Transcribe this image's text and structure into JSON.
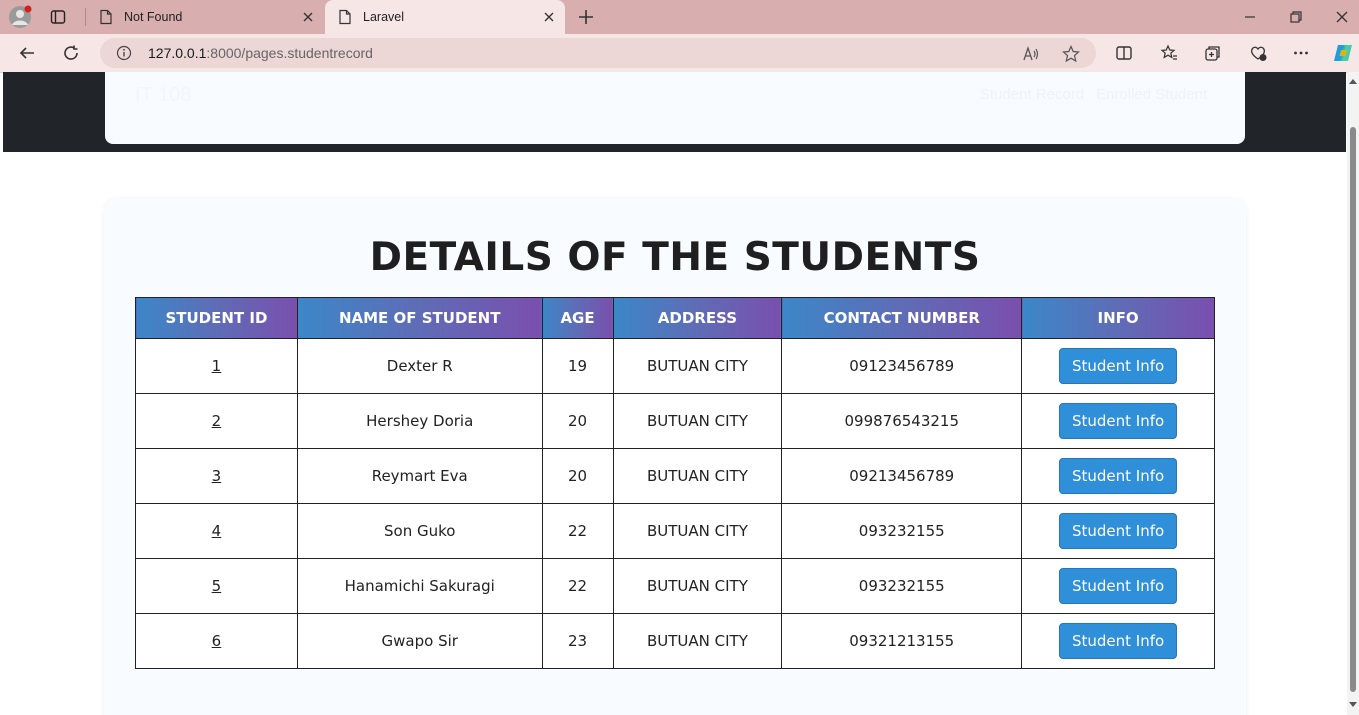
{
  "browser": {
    "tabs": [
      {
        "title": "Not Found",
        "active": false
      },
      {
        "title": "Laravel",
        "active": true
      }
    ],
    "url": {
      "host": "127.0.0.1",
      "path": ":8000/pages.studentrecord"
    }
  },
  "site": {
    "brand": "IT 108",
    "nav": [
      "Student Record",
      "Enrolled Student"
    ]
  },
  "page": {
    "title": "DETAILS OF THE STUDENTS"
  },
  "table": {
    "headers": [
      "STUDENT ID",
      "NAME OF STUDENT",
      "AGE",
      "ADDRESS",
      "CONTACT NUMBER",
      "INFO"
    ],
    "button_label": "Student Info",
    "rows": [
      {
        "id": "1",
        "name": "Dexter R",
        "age": "19",
        "address": "BUTUAN CITY",
        "contact": "09123456789"
      },
      {
        "id": "2",
        "name": "Hershey Doria",
        "age": "20",
        "address": "BUTUAN CITY",
        "contact": "099876543215"
      },
      {
        "id": "3",
        "name": "Reymart Eva",
        "age": "20",
        "address": "BUTUAN CITY",
        "contact": "09213456789"
      },
      {
        "id": "4",
        "name": "Son Guko",
        "age": "22",
        "address": "BUTUAN CITY",
        "contact": "093232155"
      },
      {
        "id": "5",
        "name": "Hanamichi Sakuragi",
        "age": "22",
        "address": "BUTUAN CITY",
        "contact": "093232155"
      },
      {
        "id": "6",
        "name": "Gwapo Sir",
        "age": "23",
        "address": "BUTUAN CITY",
        "contact": "09321213155"
      }
    ]
  },
  "colors": {
    "tabbar": "#d8aeae",
    "header_dark": "#212529",
    "button_blue": "#2f8fd8",
    "gradient_start": "#3c87c8",
    "gradient_end": "#7a4fae"
  }
}
